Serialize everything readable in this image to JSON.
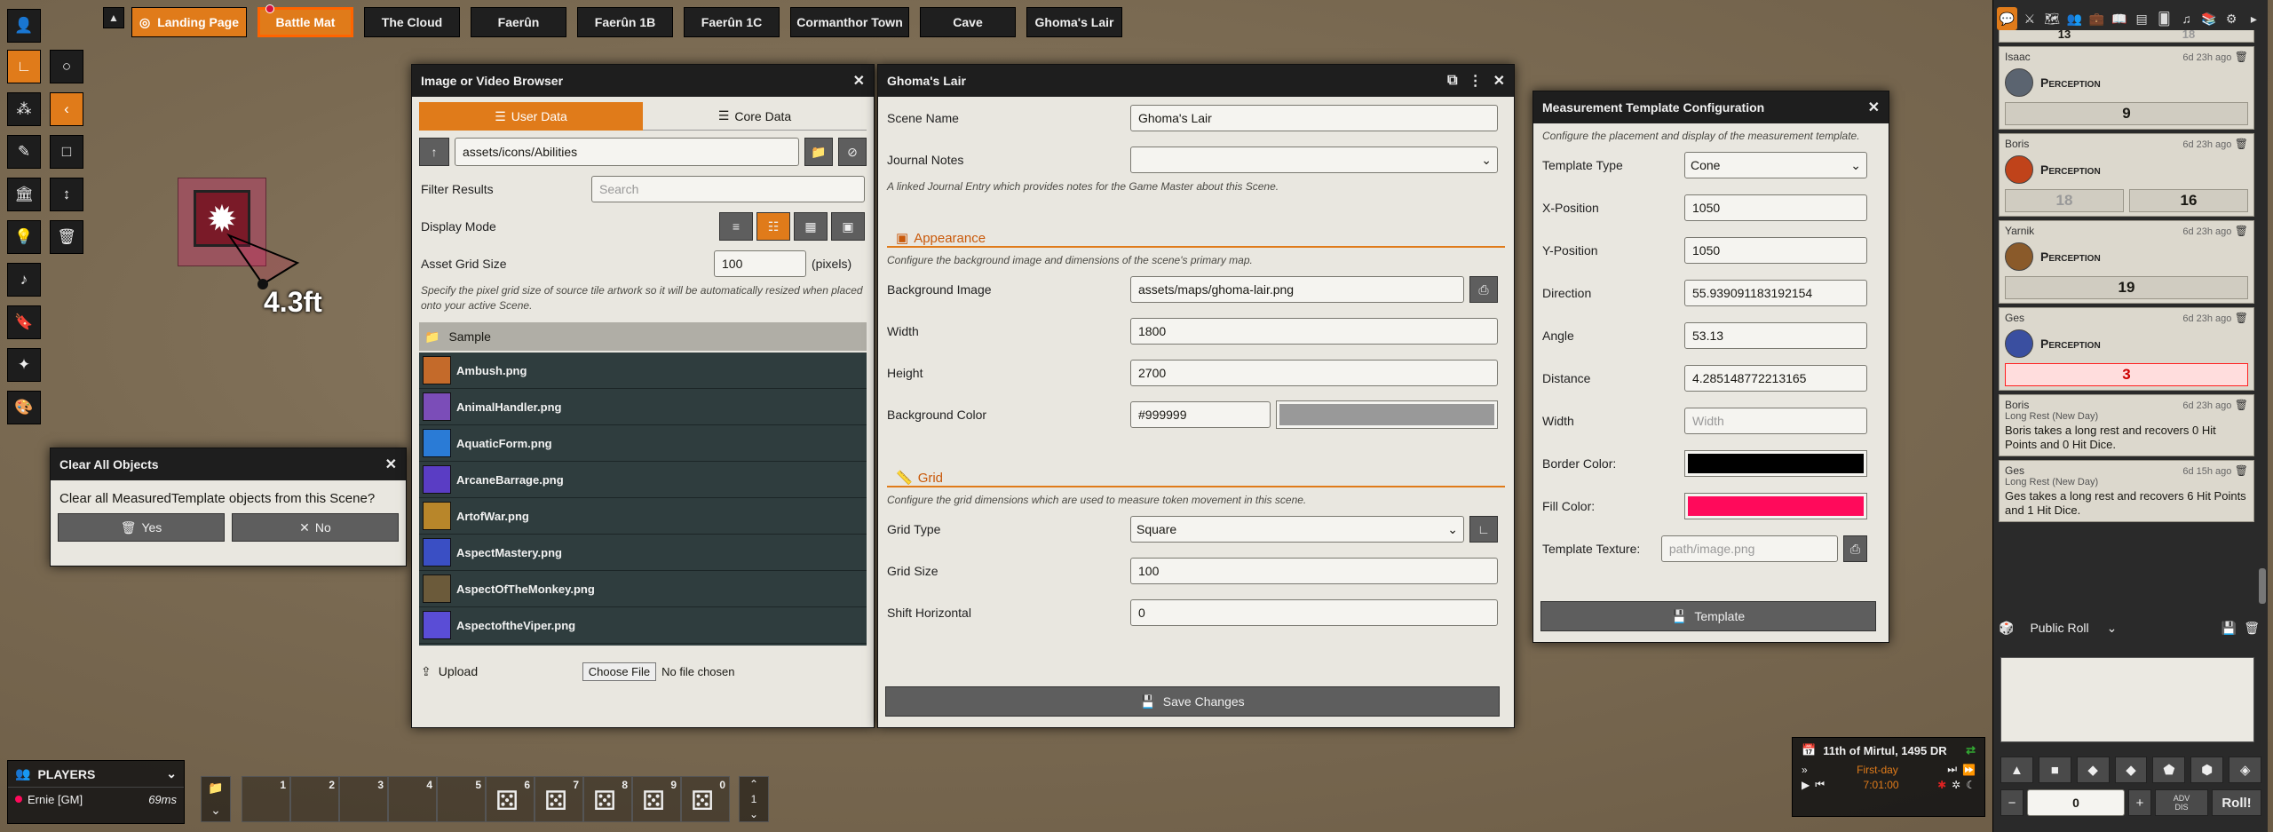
{
  "scene_nav": {
    "scenes": [
      {
        "label": "Landing Page"
      },
      {
        "label": "Battle Mat"
      },
      {
        "label": "The Cloud"
      },
      {
        "label": "Faerûn"
      },
      {
        "label": "Faerûn 1B"
      },
      {
        "label": "Faerûn 1C"
      },
      {
        "label": "Cormanthor Town"
      },
      {
        "label": "Cave"
      },
      {
        "label": "Ghoma's Lair"
      }
    ]
  },
  "canvas": {
    "measure_label": "4.3ft"
  },
  "file_browser": {
    "title": "Image or Video Browser",
    "tabs": [
      "User Data",
      "Core Data"
    ],
    "path": "assets/icons/Abilities",
    "filter_label": "Filter Results",
    "filter_placeholder": "Search",
    "display_mode_label": "Display Mode",
    "grid_size_label": "Asset Grid Size",
    "grid_size_value": "100",
    "grid_size_unit": "(pixels)",
    "grid_size_hint": "Specify the pixel grid size of source tile artwork so it will be automatically resized when placed onto your active Scene.",
    "folder_name": "Sample",
    "files": [
      {
        "name": "Ambush.png",
        "color": "#c46a2a"
      },
      {
        "name": "AnimalHandler.png",
        "color": "#7b4db8"
      },
      {
        "name": "AquaticForm.png",
        "color": "#2a7bd6"
      },
      {
        "name": "ArcaneBarrage.png",
        "color": "#5a3dc4"
      },
      {
        "name": "ArtofWar.png",
        "color": "#b8862a"
      },
      {
        "name": "AspectMastery.png",
        "color": "#3a4fc4"
      },
      {
        "name": "AspectOfTheMonkey.png",
        "color": "#6b5a3a"
      },
      {
        "name": "AspectoftheViper.png",
        "color": "#5a4dd6"
      }
    ],
    "upload_label": "Upload",
    "choose_file_label": "Choose File",
    "no_file_label": "No file chosen"
  },
  "scene_config": {
    "title": "Ghoma's Lair",
    "scene_name_label": "Scene Name",
    "scene_name_value": "Ghoma's Lair",
    "journal_label": "Journal Notes",
    "journal_hint": "A linked Journal Entry which provides notes for the Game Master about this Scene.",
    "appearance_heading": "Appearance",
    "appearance_hint": "Configure the background image and dimensions of the scene's primary map.",
    "bg_image_label": "Background Image",
    "bg_image_value": "assets/maps/ghoma-lair.png",
    "width_label": "Width",
    "width_value": "1800",
    "height_label": "Height",
    "height_value": "2700",
    "bg_color_label": "Background Color",
    "bg_color_value": "#999999",
    "grid_heading": "Grid",
    "grid_hint": "Configure the grid dimensions which are used to measure token movement in this scene.",
    "grid_type_label": "Grid Type",
    "grid_type_value": "Square",
    "grid_size_label": "Grid Size",
    "grid_size_value": "100",
    "shift_h_label": "Shift Horizontal",
    "shift_h_value": "0",
    "save_label": "Save Changes"
  },
  "clear_dialog": {
    "title": "Clear All Objects",
    "message": "Clear all MeasuredTemplate objects from this Scene?",
    "yes_label": "Yes",
    "no_label": "No"
  },
  "template_config": {
    "title": "Measurement Template Configuration",
    "hint": "Configure the placement and display of the measurement template.",
    "type_label": "Template Type",
    "type_value": "Cone",
    "x_label": "X-Position",
    "x_value": "1050",
    "y_label": "Y-Position",
    "y_value": "1050",
    "direction_label": "Direction",
    "direction_value": "55.939091183192154",
    "angle_label": "Angle",
    "angle_value": "53.13",
    "distance_label": "Distance",
    "distance_value": "4.285148772213165",
    "width_label": "Width",
    "width_placeholder": "Width",
    "border_label": "Border Color:",
    "border_color": "#000000",
    "fill_label": "Fill Color:",
    "fill_color": "#ff0a5b",
    "texture_label": "Template Texture:",
    "texture_placeholder": "path/image.png",
    "submit_label": "Template"
  },
  "chat": {
    "partial_top": {
      "left": "13",
      "right": "18"
    },
    "messages": [
      {
        "speaker": "Isaac",
        "time": "6d 23h ago",
        "check": "Perception",
        "total": "9",
        "avatar_color": "#5b6470"
      },
      {
        "speaker": "Boris",
        "time": "6d 23h ago",
        "check": "Perception",
        "dim": "18",
        "total": "16",
        "avatar_color": "#c0431a"
      },
      {
        "speaker": "Yarnik",
        "time": "6d 23h ago",
        "check": "Perception",
        "total": "19",
        "avatar_color": "#8a5a2a"
      },
      {
        "speaker": "Ges",
        "time": "6d 23h ago",
        "check": "Perception",
        "total": "3",
        "fail": true,
        "avatar_color": "#3a4fa0"
      }
    ],
    "rests": [
      {
        "speaker": "Boris",
        "time": "6d 23h ago",
        "subtitle": "Long Rest (New Day)",
        "text": "Boris takes a long rest and recovers 0 Hit Points and 0 Hit Dice."
      },
      {
        "speaker": "Ges",
        "time": "6d 15h ago",
        "subtitle": "Long Rest (New Day)",
        "text": "Ges takes a long rest and recovers 6 Hit Points and 1 Hit Dice."
      }
    ],
    "roll_mode": "Public Roll",
    "modifier_value": "0",
    "adv_label": "ADV",
    "dis_label": "DIS",
    "roll_label": "Roll!"
  },
  "players": {
    "heading": "PLAYERS",
    "list": [
      {
        "name": "Ernie [GM]",
        "ping": "69ms"
      }
    ]
  },
  "hotbar": {
    "slots": [
      "1",
      "2",
      "3",
      "4",
      "5",
      "6",
      "7",
      "8",
      "9",
      "0"
    ],
    "page": "1"
  },
  "calendar": {
    "date": "11th of Mirtul, 1495 DR",
    "day_label": "First-day",
    "time": "7:01:00"
  }
}
